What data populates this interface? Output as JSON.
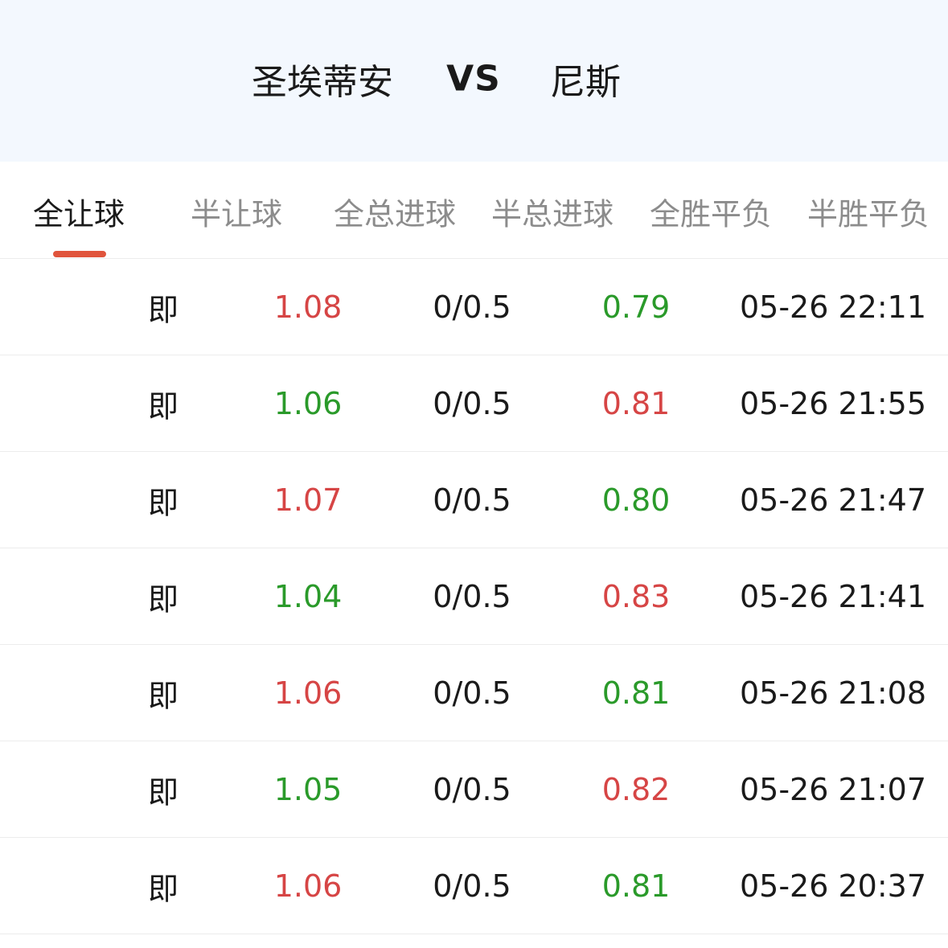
{
  "match": {
    "home_team": "圣埃蒂安",
    "vs_label": "VS",
    "away_team": "尼斯"
  },
  "tabs": [
    {
      "label": "全让球",
      "active": true
    },
    {
      "label": "半让球",
      "active": false
    },
    {
      "label": "全总进球",
      "active": false
    },
    {
      "label": "半总进球",
      "active": false
    },
    {
      "label": "全胜平负",
      "active": false
    },
    {
      "label": "半胜平负",
      "active": false
    }
  ],
  "colors": {
    "header_bg": "#f3f8fe",
    "accent": "#e0543c",
    "up": "#d64545",
    "down": "#2a9a2a"
  },
  "rows": [
    {
      "type": "即",
      "home_odds": "1.08",
      "home_trend": "up",
      "line": "0/0.5",
      "away_odds": "0.79",
      "away_trend": "down",
      "time": "05-26 22:11"
    },
    {
      "type": "即",
      "home_odds": "1.06",
      "home_trend": "down",
      "line": "0/0.5",
      "away_odds": "0.81",
      "away_trend": "up",
      "time": "05-26 21:55"
    },
    {
      "type": "即",
      "home_odds": "1.07",
      "home_trend": "up",
      "line": "0/0.5",
      "away_odds": "0.80",
      "away_trend": "down",
      "time": "05-26 21:47"
    },
    {
      "type": "即",
      "home_odds": "1.04",
      "home_trend": "down",
      "line": "0/0.5",
      "away_odds": "0.83",
      "away_trend": "up",
      "time": "05-26 21:41"
    },
    {
      "type": "即",
      "home_odds": "1.06",
      "home_trend": "up",
      "line": "0/0.5",
      "away_odds": "0.81",
      "away_trend": "down",
      "time": "05-26 21:08"
    },
    {
      "type": "即",
      "home_odds": "1.05",
      "home_trend": "down",
      "line": "0/0.5",
      "away_odds": "0.82",
      "away_trend": "up",
      "time": "05-26 21:07"
    },
    {
      "type": "即",
      "home_odds": "1.06",
      "home_trend": "up",
      "line": "0/0.5",
      "away_odds": "0.81",
      "away_trend": "down",
      "time": "05-26 20:37"
    }
  ]
}
